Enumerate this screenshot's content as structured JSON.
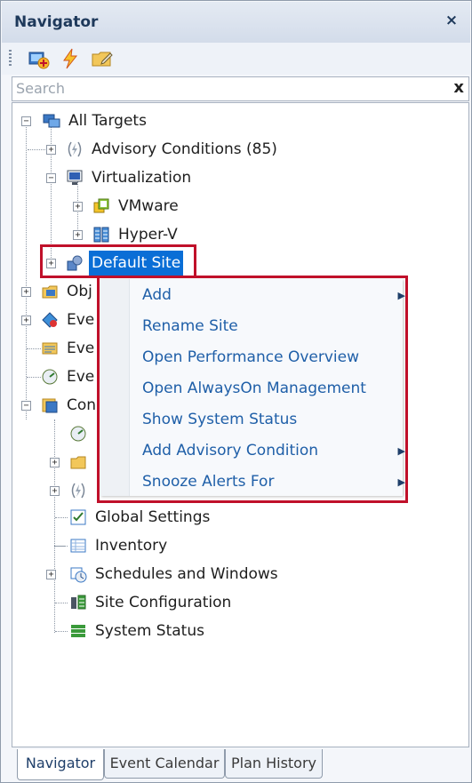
{
  "panel": {
    "title": "Navigator",
    "close_label": "×"
  },
  "toolbar": {
    "buttons": [
      {
        "icon": "add-target-icon"
      },
      {
        "icon": "lightning-icon"
      },
      {
        "icon": "folder-edit-icon"
      }
    ]
  },
  "search": {
    "placeholder": "Search",
    "value": "",
    "clear_label": "x"
  },
  "tree": {
    "all_targets": "All Targets",
    "advisory_conditions": "Advisory Conditions (85)",
    "virtualization": "Virtualization",
    "vmware": "VMware",
    "hyperv": "Hyper-V",
    "default_site": "Default Site",
    "objects_partial": "Obj",
    "events1_partial": "Eve",
    "events2_partial": "Eve",
    "events3_partial": "Eve",
    "configuration_partial": "Con",
    "global_settings": "Global Settings",
    "inventory": "Inventory",
    "schedules": "Schedules and Windows",
    "site_config": "Site Configuration",
    "system_status": "System Status"
  },
  "context_menu": {
    "items": [
      {
        "label": "Add",
        "submenu": true
      },
      {
        "label": "Rename Site",
        "submenu": false
      },
      {
        "label": "Open Performance Overview",
        "submenu": false
      },
      {
        "label": "Open AlwaysOn Management",
        "submenu": false
      },
      {
        "label": "Show System Status",
        "submenu": false
      },
      {
        "label": "Add Advisory Condition",
        "submenu": true
      },
      {
        "label": "Snooze Alerts For",
        "submenu": true
      }
    ],
    "arrow_glyph": "▶"
  },
  "tabs": [
    {
      "label": "Navigator",
      "active": true
    },
    {
      "label": "Event Calendar",
      "active": false
    },
    {
      "label": "Plan History",
      "active": false
    }
  ],
  "colors": {
    "selection": "#0a6ed6",
    "highlight_box": "#c0102a",
    "menu_text": "#1f5fa8"
  }
}
